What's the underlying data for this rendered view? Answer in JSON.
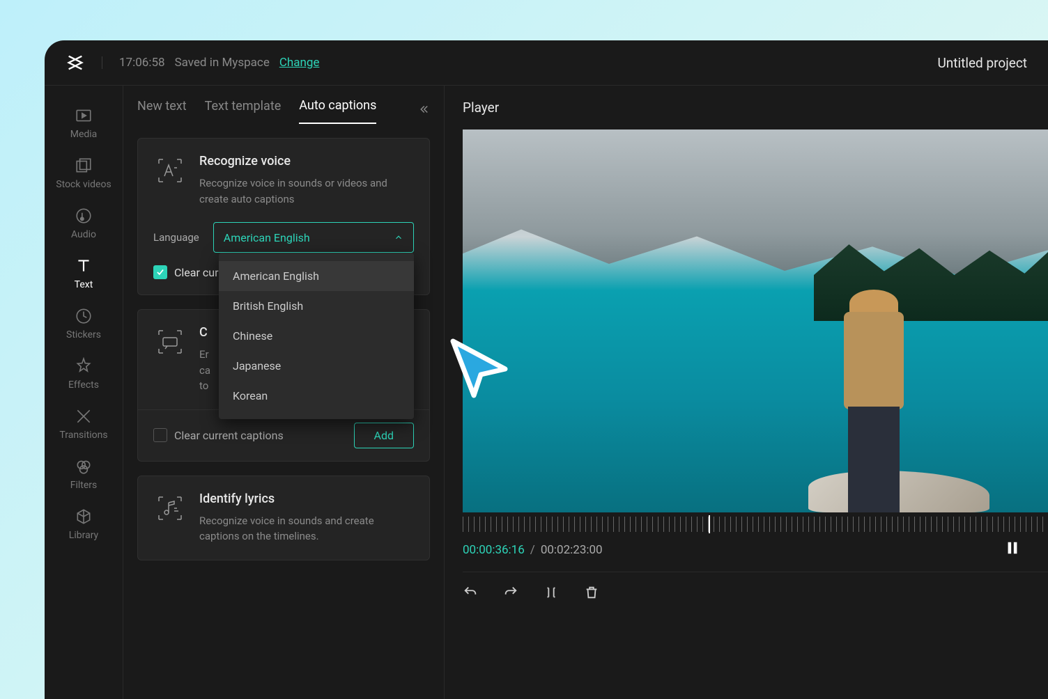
{
  "topbar": {
    "time": "17:06:58",
    "saved": "Saved in Myspace",
    "change": "Change",
    "title": "Untitled project"
  },
  "sidebar": {
    "items": [
      {
        "label": "Media"
      },
      {
        "label": "Stock videos"
      },
      {
        "label": "Audio"
      },
      {
        "label": "Text"
      },
      {
        "label": "Stickers"
      },
      {
        "label": "Effects"
      },
      {
        "label": "Transitions"
      },
      {
        "label": "Filters"
      },
      {
        "label": "Library"
      }
    ]
  },
  "tabs": {
    "new_text": "New text",
    "text_template": "Text template",
    "auto_captions": "Auto captions"
  },
  "recognize": {
    "title": "Recognize voice",
    "desc": "Recognize voice in sounds or videos and create auto captions",
    "lang_label": "Language",
    "selected": "American English",
    "options": [
      "American English",
      "British English",
      "Chinese",
      "Japanese",
      "Korean"
    ],
    "clear_label": "Clear current captions"
  },
  "card2": {
    "clear_label": "Clear current captions",
    "add": "Add"
  },
  "lyrics": {
    "title": "Identify lyrics",
    "desc": "Recognize voice in sounds and create captions on the timelines."
  },
  "player": {
    "title": "Player",
    "current_time": "00:00:36:16",
    "duration": "00:02:23:00"
  }
}
